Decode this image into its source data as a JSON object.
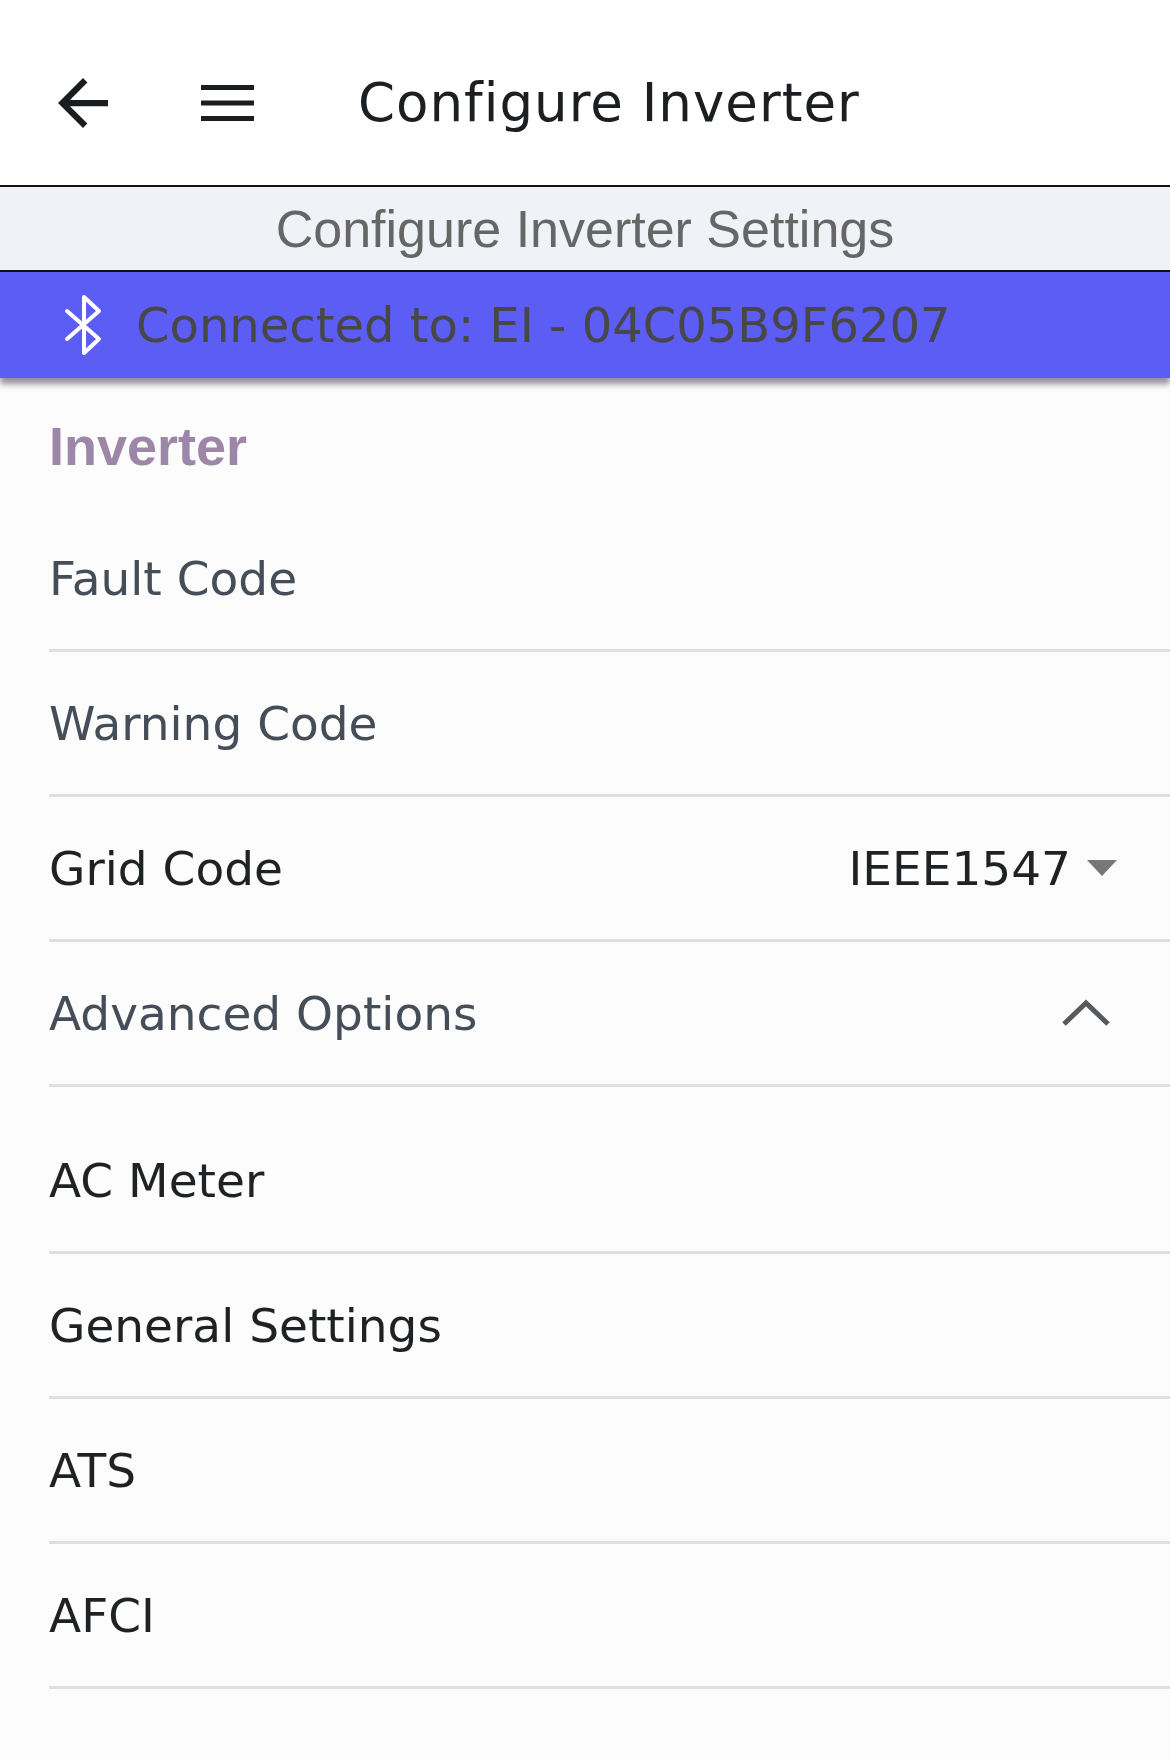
{
  "header": {
    "title": "Configure Inverter"
  },
  "subheader": {
    "title": "Configure Inverter Settings"
  },
  "connection_bar": {
    "text": "Connected to: EI - 04C05B9F6207"
  },
  "section": {
    "title": "Inverter",
    "rows": [
      {
        "kind": "readout",
        "label": "Fault Code"
      },
      {
        "kind": "readout",
        "label": "Warning Code"
      },
      {
        "kind": "dropdown",
        "label": "Grid Code",
        "value": "IEEE1547"
      },
      {
        "kind": "expander",
        "label": "Advanced Options",
        "expanded": true,
        "children": [
          {
            "kind": "link",
            "label": "AC Meter"
          },
          {
            "kind": "link",
            "label": "General Settings"
          },
          {
            "kind": "link",
            "label": "ATS"
          },
          {
            "kind": "link",
            "label": "AFCI"
          }
        ]
      }
    ]
  }
}
